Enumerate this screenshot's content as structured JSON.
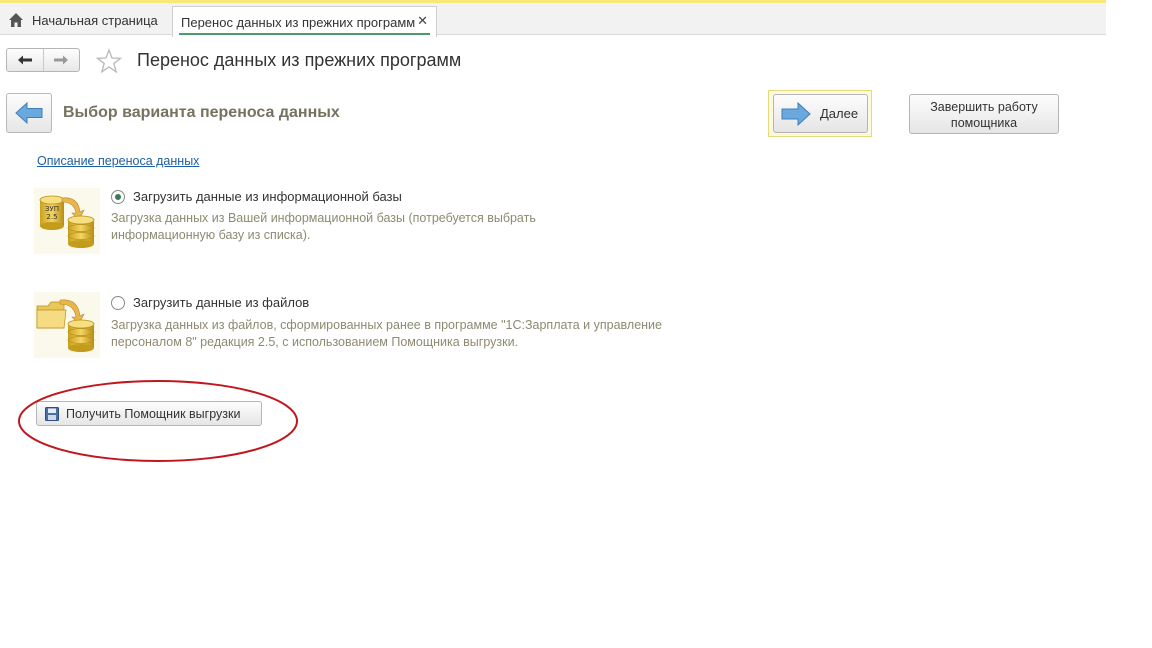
{
  "tabs": {
    "home_label": "Начальная страница",
    "active_label": "Перенос данных из прежних программ",
    "close_glyph": "✕"
  },
  "page": {
    "title": "Перенос данных из прежних программ"
  },
  "wizard": {
    "section_title": "Выбор варианта переноса данных",
    "next_label": "Далее",
    "finish_line1": "Завершить работу",
    "finish_line2": "помощника",
    "description_link": "Описание переноса данных"
  },
  "options": [
    {
      "label": "Загрузить данные из информационной базы",
      "desc_line1": "Загрузка данных из Вашей информационной базы (потребуется выбрать",
      "desc_line2": "информационную базу из списка).",
      "icon_text_line1": "ЗУП",
      "icon_text_line2": "2.5",
      "selected": true
    },
    {
      "label": "Загрузить данные из файлов",
      "desc_line1": "Загрузка данных из файлов, сформированных ранее в программе \"1С:Зарплата и управление",
      "desc_line2": "персоналом 8\" редакция 2.5, с использованием Помощника выгрузки.",
      "selected": false
    }
  ],
  "unload_button": {
    "label": "Получить Помощник выгрузки"
  },
  "colors": {
    "accent_yellow": "#f7e879",
    "annotation_red": "#c0161d",
    "link_blue": "#1d5fa3",
    "arrow_blue": "#5aa0d8"
  }
}
